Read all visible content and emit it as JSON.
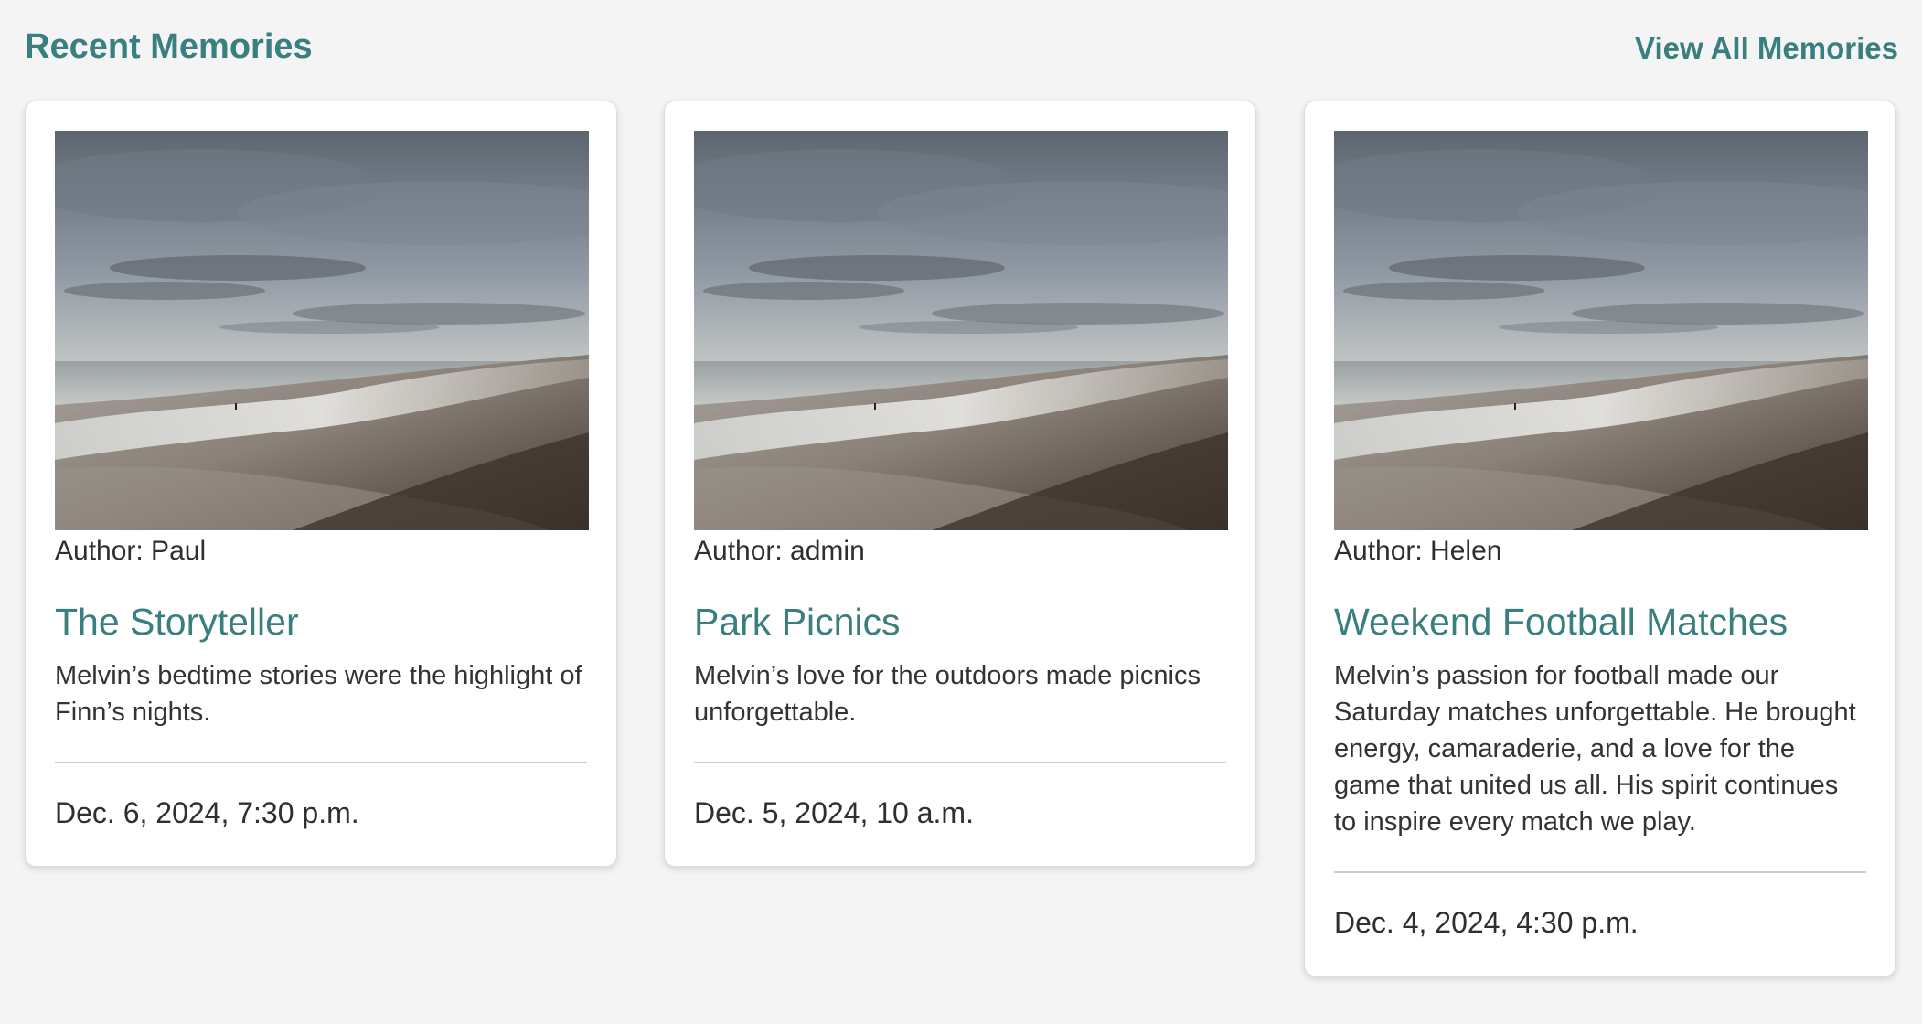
{
  "header": {
    "title": "Recent Memories",
    "view_all_label": "View All Memories"
  },
  "colors": {
    "accent": "#3a7f7f",
    "background": "#f4f4f4",
    "card": "#ffffff"
  },
  "cards": [
    {
      "author": "Author: Paul",
      "title": "The Storyteller",
      "excerpt": "Melvin’s bedtime stories were the highlight of Finn’s nights.",
      "date": "Dec. 6, 2024, 7:30 p.m."
    },
    {
      "author": "Author: admin",
      "title": "Park Picnics",
      "excerpt": "Melvin’s love for the outdoors made picnics unforgettable.",
      "date": "Dec. 5, 2024, 10 a.m."
    },
    {
      "author": "Author: Helen",
      "title": "Weekend Football Matches",
      "excerpt": "Melvin’s passion for football made our Saturday matches unforgettable. He brought energy, camaraderie, and a love for the game that united us all. His spirit continues to inspire every match we play.",
      "date": "Dec. 4, 2024, 4:30 p.m."
    }
  ]
}
